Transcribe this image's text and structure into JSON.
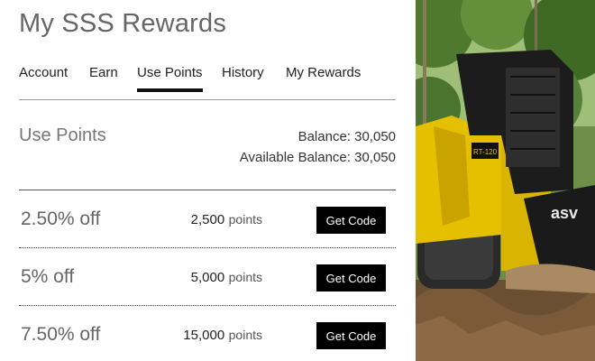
{
  "page": {
    "title": "My SSS Rewards"
  },
  "tabs": [
    {
      "label": "Account"
    },
    {
      "label": "Earn"
    },
    {
      "label": "Use Points"
    },
    {
      "label": "History"
    },
    {
      "label": "My Rewards"
    }
  ],
  "active_tab": "Use Points",
  "section": {
    "title": "Use Points",
    "balance_text": "Balance: 30,050",
    "available_balance_text": "Available Balance: 30,050"
  },
  "rewards": [
    {
      "discount": "2.50% off",
      "points": "2,500",
      "points_unit": "points",
      "button": "Get Code"
    },
    {
      "discount": "5% off",
      "points": "5,000",
      "points_unit": "points",
      "button": "Get Code"
    },
    {
      "discount": "7.50% off",
      "points": "15,000",
      "points_unit": "points",
      "button": "Get Code"
    }
  ],
  "photo": {
    "machine_badge": "RT-120",
    "brand_mark": "asv"
  },
  "colors": {
    "button_bg": "#000000",
    "button_text": "#ffffff",
    "active_tab_underline": "#111111",
    "machine_yellow": "#e5c000"
  }
}
